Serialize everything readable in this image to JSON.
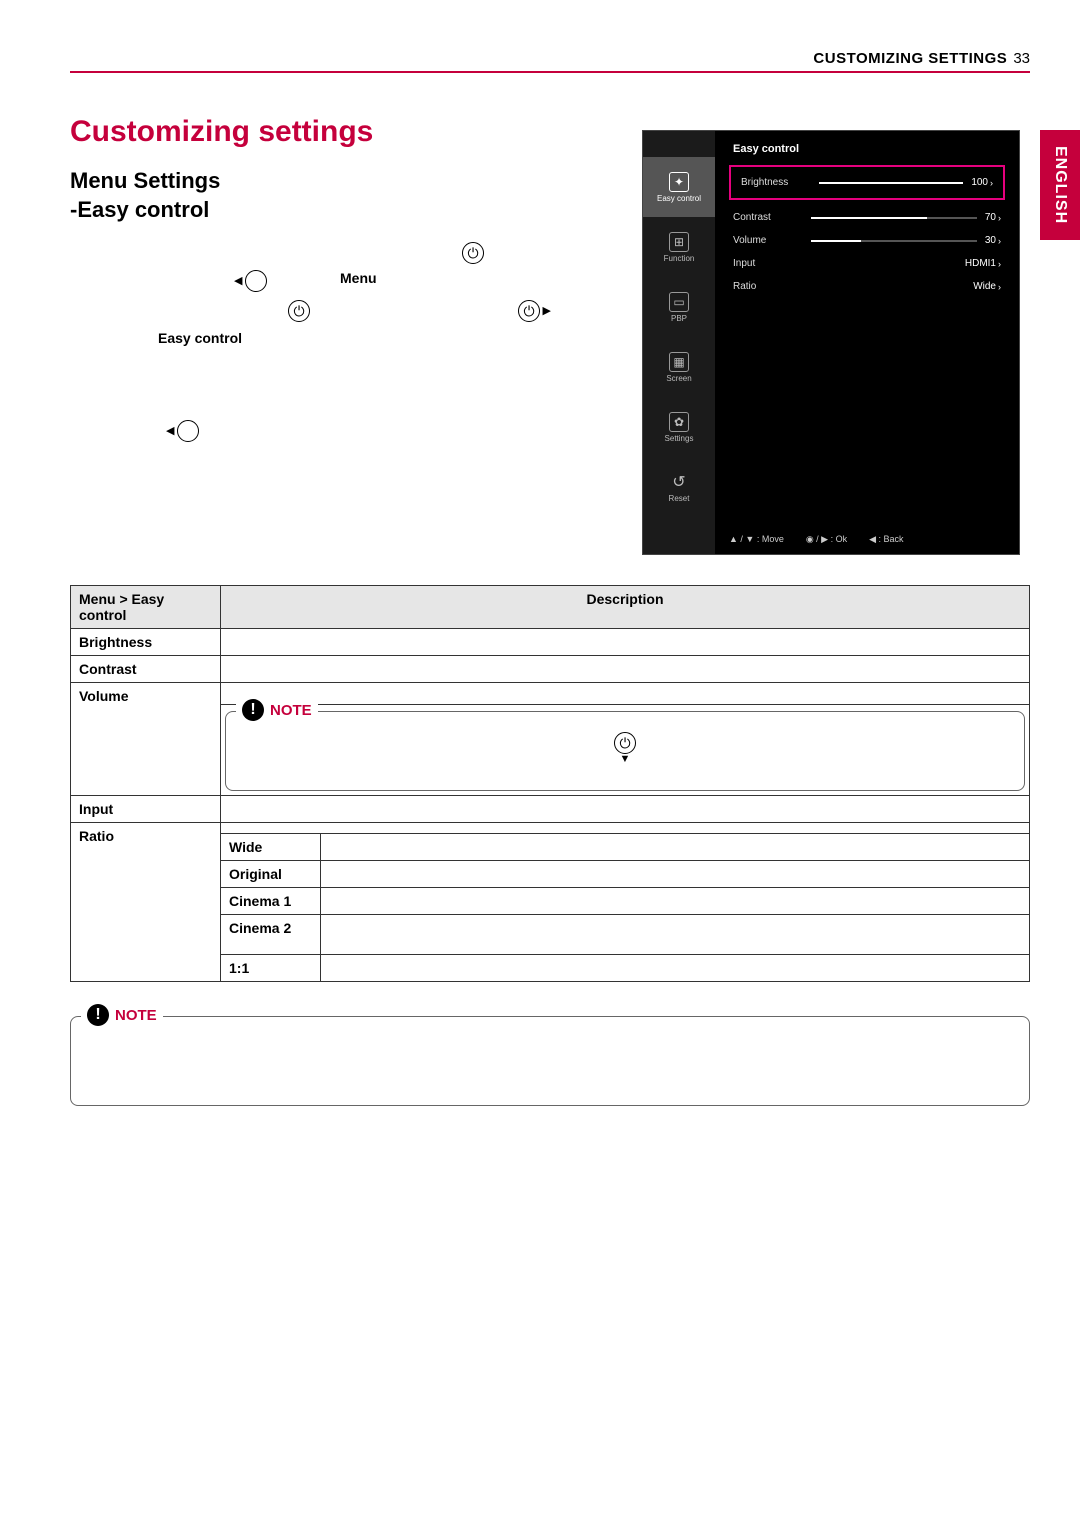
{
  "header": {
    "section": "CUSTOMIZING SETTINGS",
    "page": "33"
  },
  "lang": "ENGLISH",
  "title": "Customizing settings",
  "subtitle1": "Menu Settings",
  "subtitle2": "-Easy control",
  "instr": {
    "menu": "Menu",
    "easy": "Easy control"
  },
  "osd": {
    "title": "Easy control",
    "sidebar": [
      {
        "label": "Easy control",
        "icon": "✦"
      },
      {
        "label": "Function",
        "icon": "⊞"
      },
      {
        "label": "PBP",
        "icon": "▭"
      },
      {
        "label": "Screen",
        "icon": "▦"
      },
      {
        "label": "Settings",
        "icon": "✿"
      },
      {
        "label": "Reset",
        "icon": "↺"
      }
    ],
    "rows": {
      "brightness": {
        "label": "Brightness",
        "value": "100",
        "pct": 100
      },
      "contrast": {
        "label": "Contrast",
        "value": "70",
        "pct": 70
      },
      "volume": {
        "label": "Volume",
        "value": "30",
        "pct": 30
      },
      "input": {
        "label": "Input",
        "value": "HDMI1"
      },
      "ratio": {
        "label": "Ratio",
        "value": "Wide"
      }
    },
    "footer": {
      "move": "▲ / ▼ : Move",
      "ok": "◉ / ▶ : Ok",
      "back": "◀ : Back"
    }
  },
  "table": {
    "head1": "Menu > Easy control",
    "head2": "Description",
    "brightness": "Brightness",
    "contrast": "Contrast",
    "volume": "Volume",
    "input": "Input",
    "ratio": "Ratio",
    "wide": "Wide",
    "original": "Original",
    "cinema1": "Cinema 1",
    "cinema2": "Cinema 2",
    "oneone": "1:1"
  },
  "note": "NOTE"
}
